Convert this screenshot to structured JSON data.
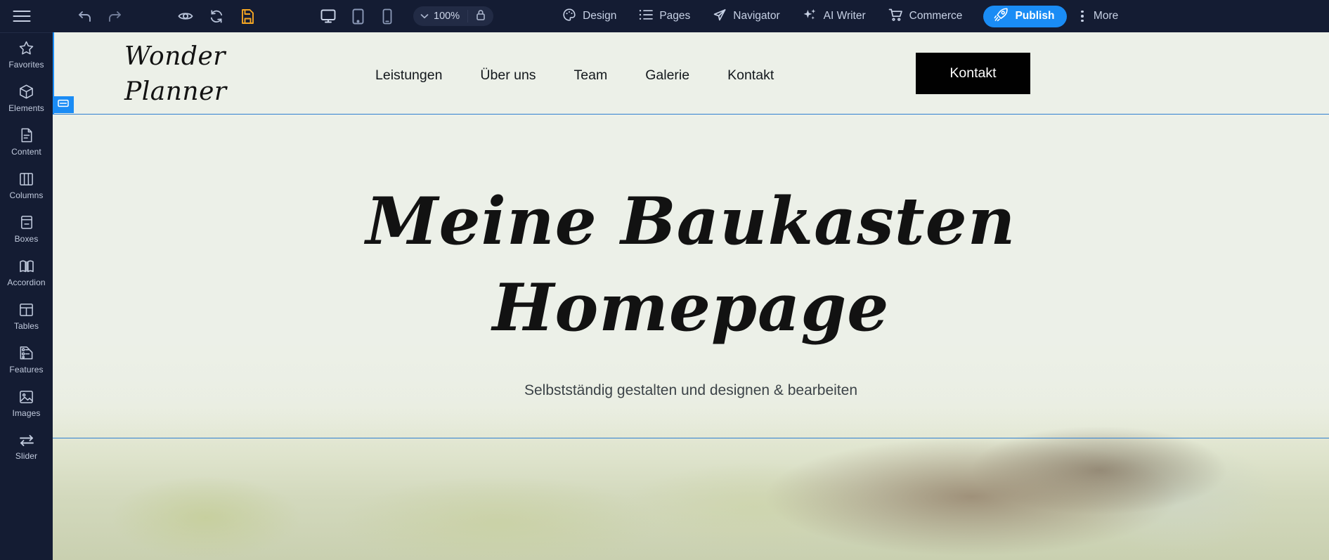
{
  "toolbar": {
    "menu_icon": "hamburger-icon",
    "undo_icon": "undo-arrow-icon",
    "redo_icon": "redo-arrow-icon",
    "preview_icon": "eye-icon",
    "reload_icon": "refresh-icon",
    "save_icon": "save-file-icon",
    "desktop_icon": "desktop-monitor-icon",
    "tablet_icon": "tablet-icon",
    "mobile_icon": "mobile-phone-icon",
    "zoom_level": "100%",
    "zoom_chevron_icon": "chevron-down-icon",
    "lock_icon": "lock-icon",
    "items": [
      {
        "label": "Design",
        "icon": "palette-icon"
      },
      {
        "label": "Pages",
        "icon": "list-icon"
      },
      {
        "label": "Navigator",
        "icon": "paper-plane-icon"
      },
      {
        "label": "AI Writer",
        "icon": "sparkle-icon"
      },
      {
        "label": "Commerce",
        "icon": "shopping-cart-icon"
      }
    ],
    "publish_label": "Publish",
    "publish_icon": "rocket-icon",
    "more_label": "More",
    "more_icon": "vertical-dots-icon",
    "accent_blue": "#1a8cf5",
    "save_orange": "#f5a623",
    "bar_background": "#141c33"
  },
  "sidebar": {
    "items": [
      {
        "label": "Favorites",
        "icon": "star-icon"
      },
      {
        "label": "Elements",
        "icon": "cube-icon"
      },
      {
        "label": "Content",
        "icon": "document-icon"
      },
      {
        "label": "Columns",
        "icon": "columns-icon"
      },
      {
        "label": "Boxes",
        "icon": "box-icon"
      },
      {
        "label": "Accordion",
        "icon": "accordion-icon"
      },
      {
        "label": "Tables",
        "icon": "table-icon"
      },
      {
        "label": "Features",
        "icon": "features-icon"
      },
      {
        "label": "Images",
        "icon": "image-icon"
      },
      {
        "label": "Slider",
        "icon": "slider-arrows-icon"
      }
    ]
  },
  "canvas": {
    "site_header": {
      "logo_line1": "Wonder",
      "logo_line2": "Planner",
      "nav": [
        {
          "label": "Leistungen"
        },
        {
          "label": "Über uns"
        },
        {
          "label": "Team"
        },
        {
          "label": "Galerie"
        },
        {
          "label": "Kontakt"
        }
      ],
      "cta_label": "Kontakt",
      "selection_badge_icon": "section-handle-icon"
    },
    "hero": {
      "title_line1": "Meine Baukasten",
      "title_line2": "Homepage",
      "subtitle": "Selbstständig gestalten und designen & bearbeiten"
    }
  }
}
